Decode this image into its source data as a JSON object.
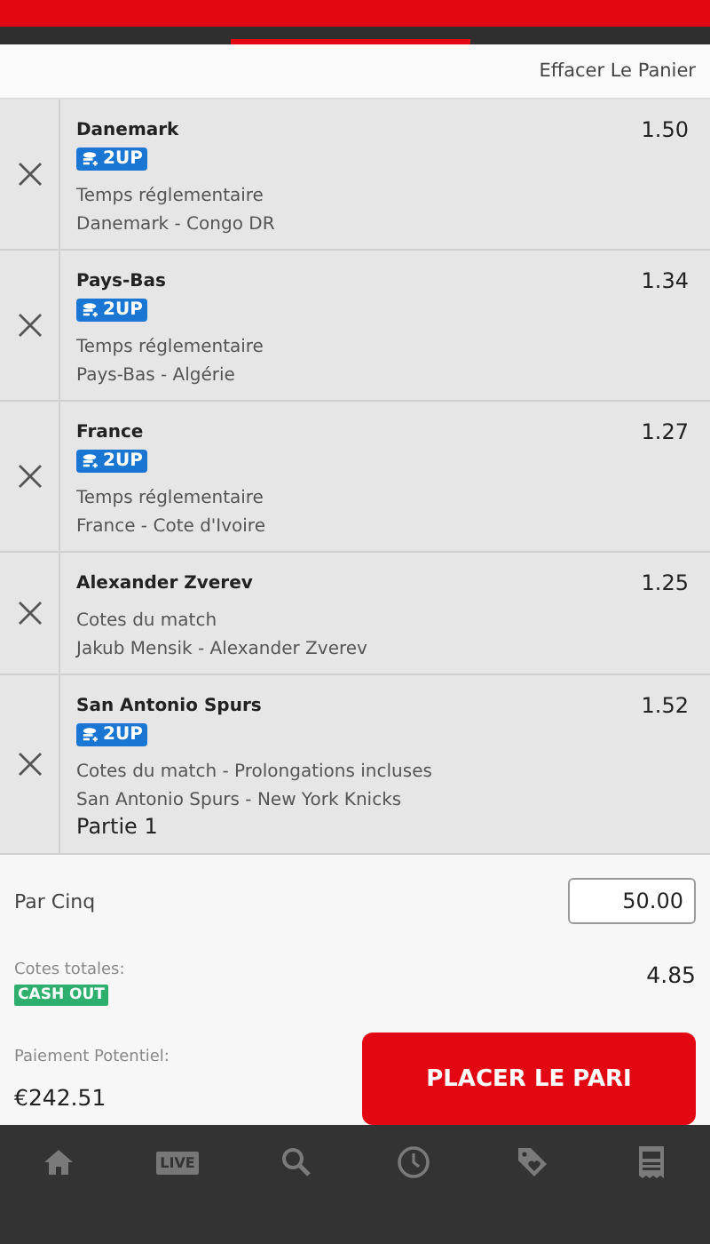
{
  "header": {
    "clear_link": "Effacer Le Panier"
  },
  "bets": [
    {
      "selection": "Danemark",
      "badge": "2UP",
      "market": "Temps réglementaire",
      "event": "Danemark - Congo DR",
      "odds": "1.50"
    },
    {
      "selection": "Pays-Bas",
      "badge": "2UP",
      "market": "Temps réglementaire",
      "event": "Pays-Bas - Algérie",
      "odds": "1.34"
    },
    {
      "selection": "France",
      "badge": "2UP",
      "market": "Temps réglementaire",
      "event": "France - Cote d'Ivoire",
      "odds": "1.27"
    },
    {
      "selection": "Alexander Zverev",
      "market": "Cotes du match",
      "event": "Jakub Mensik - Alexander Zverev",
      "odds": "1.25"
    },
    {
      "selection": "San Antonio Spurs",
      "badge": "2UP",
      "market": "Cotes du match - Prolongations incluses",
      "event": "San Antonio Spurs - New York Knicks",
      "note": "Partie 1",
      "odds": "1.52"
    }
  ],
  "stake": {
    "label": "Par Cinq",
    "value": "50.00"
  },
  "total_odds": {
    "label": "Cotes totales:",
    "value": "4.85",
    "badge": "CASH OUT"
  },
  "payout": {
    "label": "Paiement Potentiel:",
    "value": "€242.51"
  },
  "place_button": "PLACER LE PARI",
  "nav": [
    {
      "kind": "home"
    },
    {
      "kind": "live",
      "label": "LIVE"
    },
    {
      "kind": "search"
    },
    {
      "kind": "clock"
    },
    {
      "kind": "tag"
    },
    {
      "kind": "receipt"
    }
  ]
}
